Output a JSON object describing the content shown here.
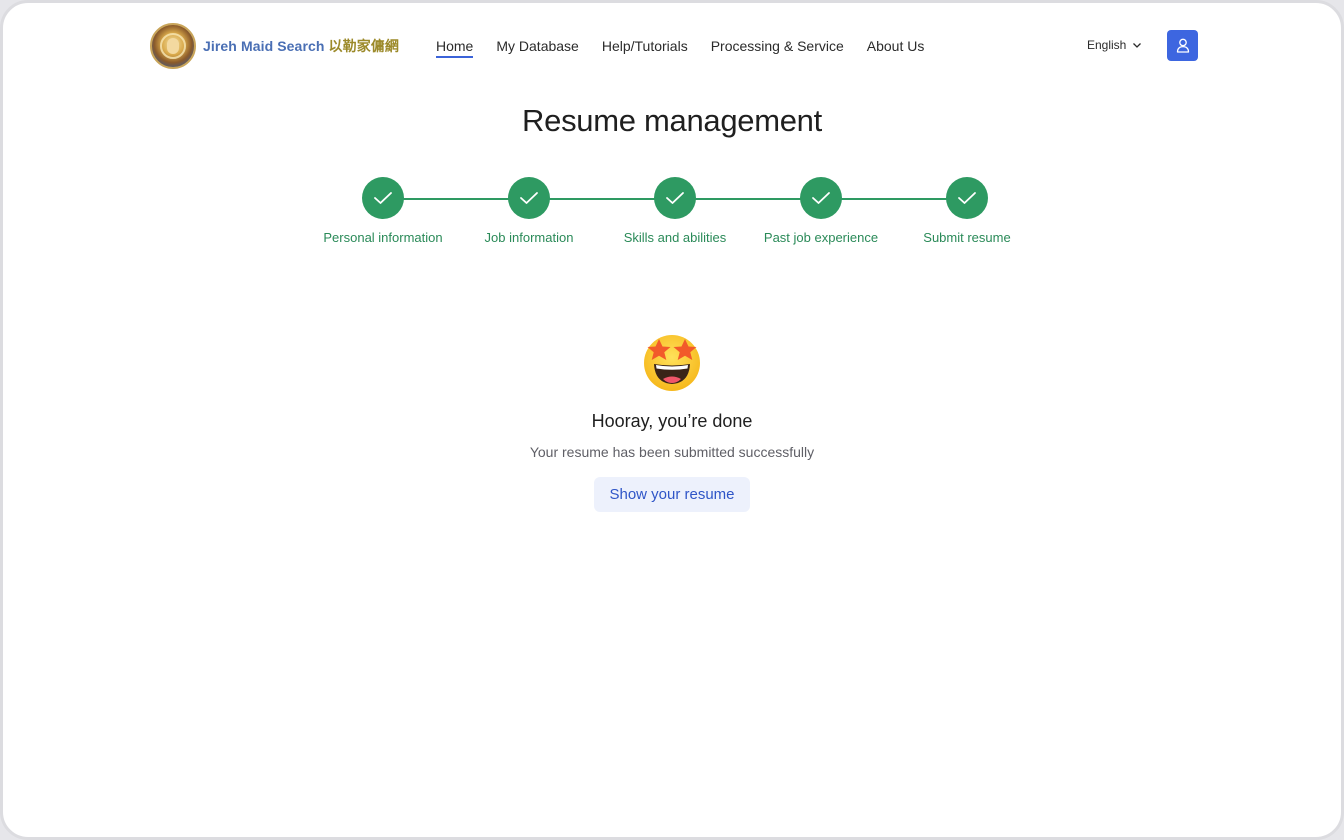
{
  "brand": {
    "name_en": "Jireh Maid Search",
    "name_zh": "以勒家傭網"
  },
  "nav": {
    "items": [
      {
        "label": "Home",
        "active": true
      },
      {
        "label": "My Database",
        "active": false
      },
      {
        "label": "Help/Tutorials",
        "active": false
      },
      {
        "label": "Processing & Service",
        "active": false
      },
      {
        "label": "About Us",
        "active": false
      }
    ]
  },
  "language": {
    "selected": "English",
    "icon": "chevron-down-icon"
  },
  "user": {
    "icon": "user-icon"
  },
  "page": {
    "title": "Resume management"
  },
  "steps": [
    {
      "label": "Personal information",
      "status": "complete"
    },
    {
      "label": "Job information",
      "status": "complete"
    },
    {
      "label": "Skills and abilities",
      "status": "complete"
    },
    {
      "label": "Past job experience",
      "status": "complete"
    },
    {
      "label": "Submit resume",
      "status": "complete"
    }
  ],
  "completion": {
    "emoji": "star-struck-emoji",
    "title": "Hooray, you’re done",
    "subtitle": "Your resume has been submitted successfully",
    "button_label": "Show your resume"
  },
  "colors": {
    "accent": "#3d66e0",
    "success": "#2e9a62",
    "brand_blue": "#4a6fb4",
    "brand_gold": "#9c8a2a"
  }
}
